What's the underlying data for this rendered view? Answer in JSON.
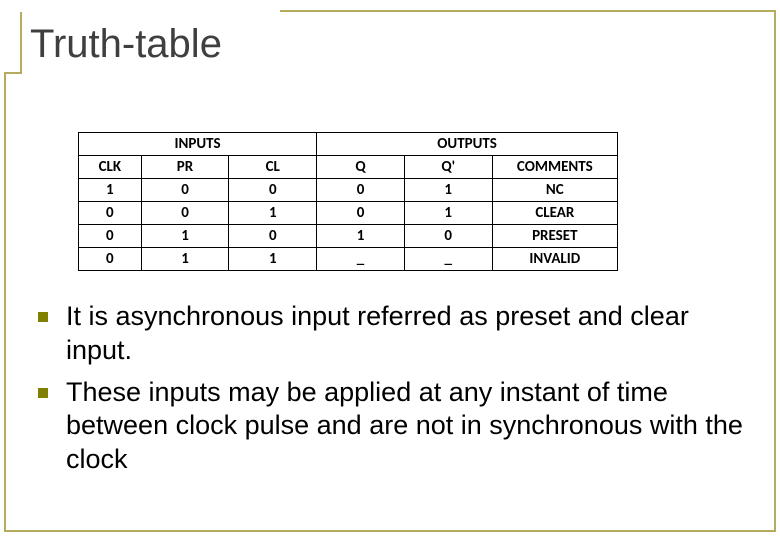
{
  "title": "Truth-table",
  "chart_data": {
    "type": "table",
    "group_headers": {
      "inputs": "INPUTS",
      "outputs": "OUTPUTS"
    },
    "columns": [
      "CLK",
      "PR",
      "CL",
      "Q",
      "Q'",
      "COMMENTS"
    ],
    "rows": [
      {
        "clk": "1",
        "pr": "0",
        "cl": "0",
        "q": "0",
        "qp": "1",
        "comment": "NC"
      },
      {
        "clk": "0",
        "pr": "0",
        "cl": "1",
        "q": "0",
        "qp": "1",
        "comment": "CLEAR"
      },
      {
        "clk": "0",
        "pr": "1",
        "cl": "0",
        "q": "1",
        "qp": "0",
        "comment": "PRESET"
      },
      {
        "clk": "0",
        "pr": "1",
        "cl": "1",
        "q": "_",
        "qp": "_",
        "comment": "INVALID"
      }
    ]
  },
  "bullets": [
    "It is asynchronous input referred as preset and clear input.",
    "These inputs may be applied at any instant of time between clock pulse and are not in synchronous with the clock"
  ]
}
